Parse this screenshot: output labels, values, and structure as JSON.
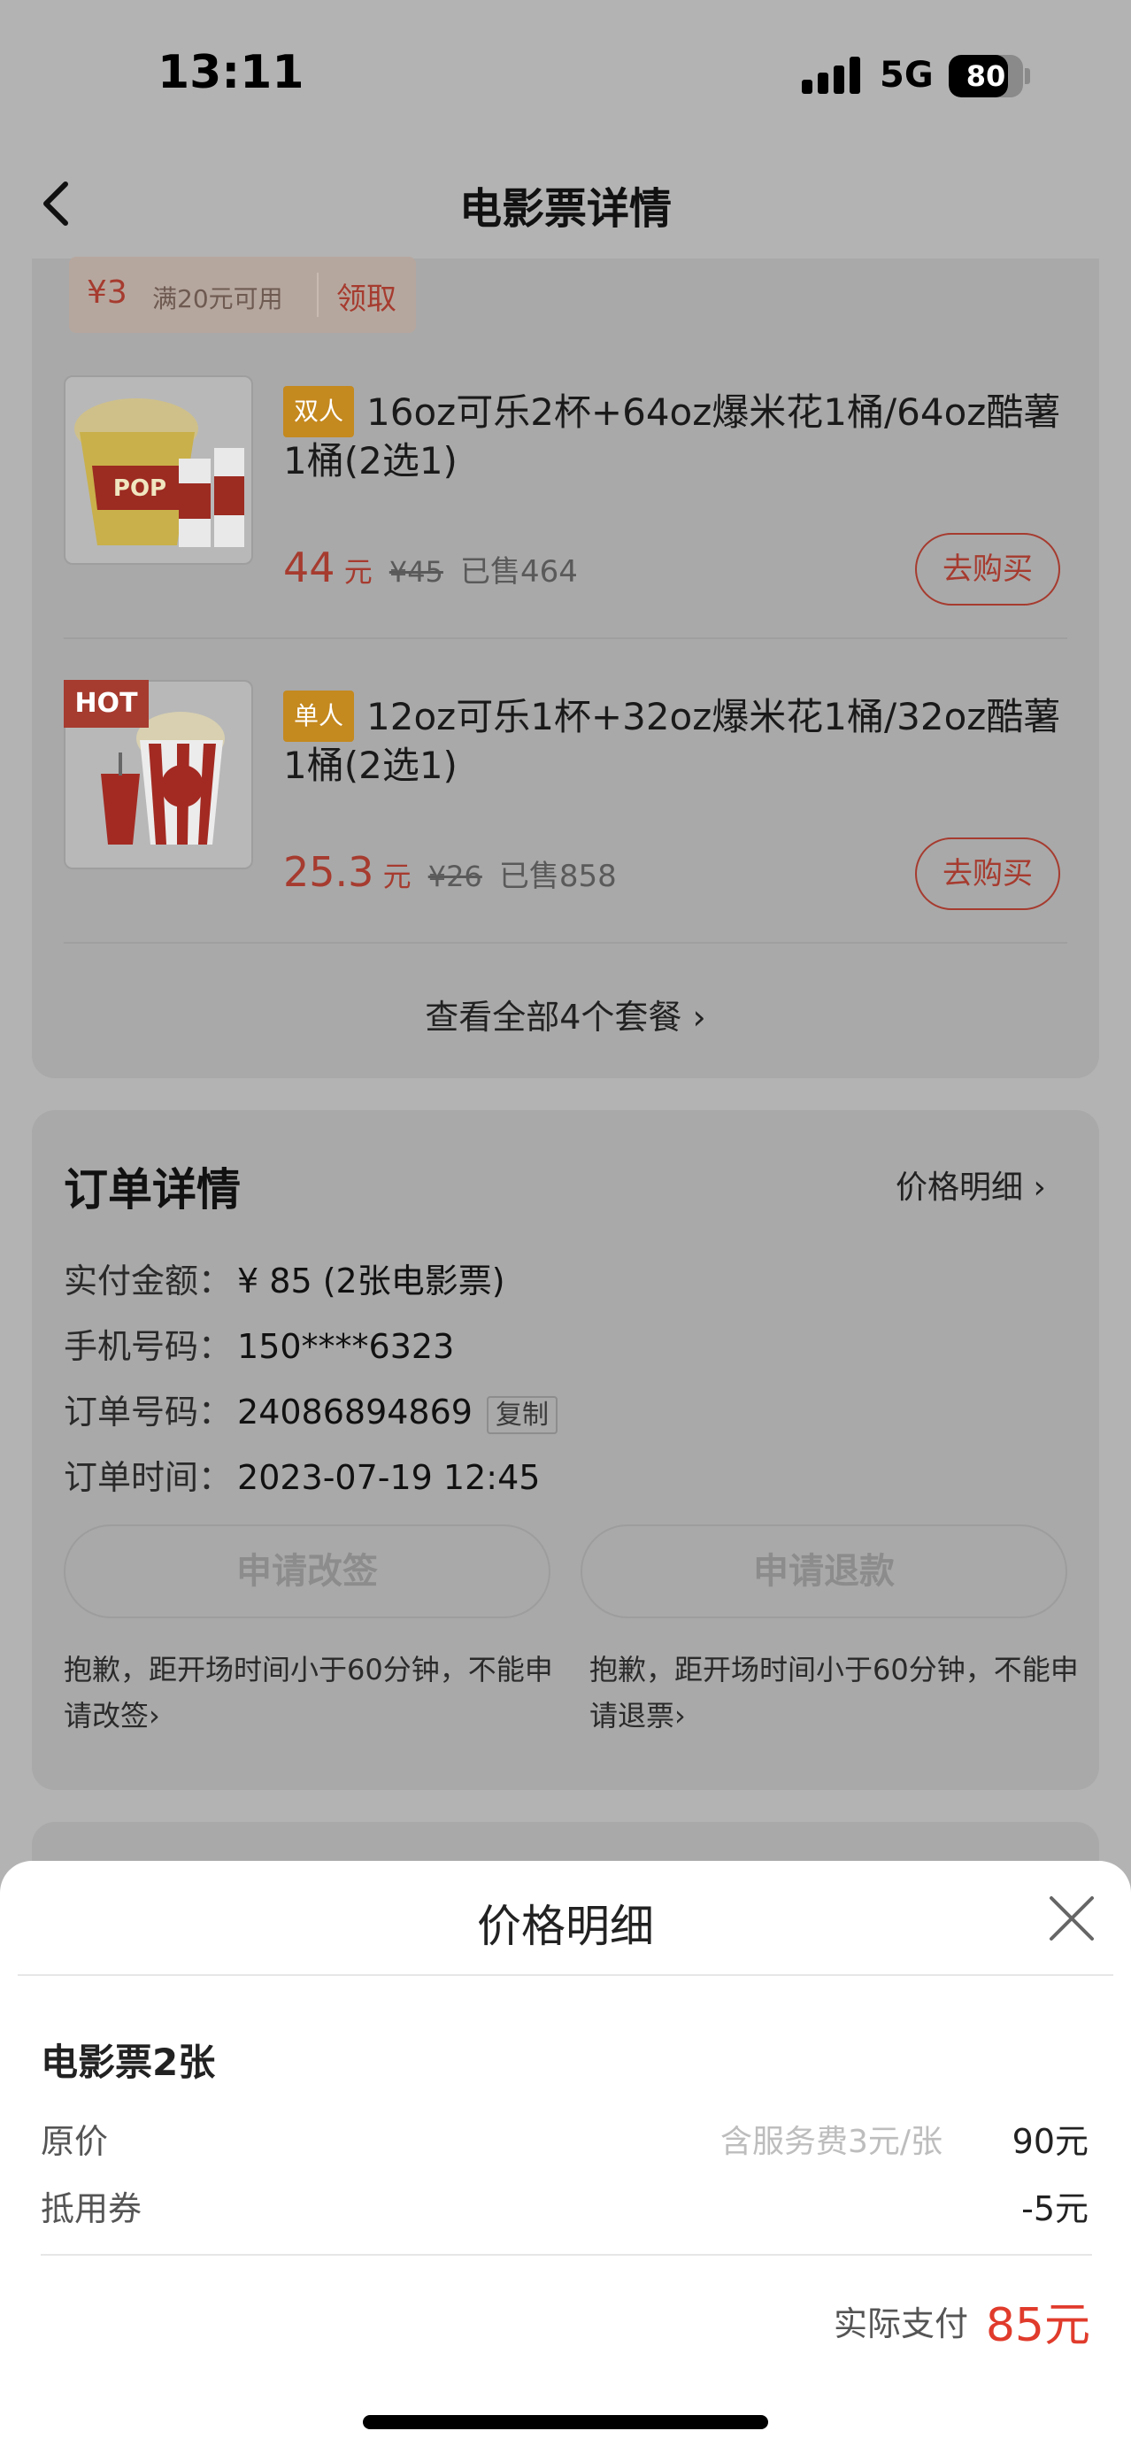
{
  "status_bar": {
    "time": "13:11",
    "network": "5G",
    "battery": "80",
    "battery_level": 0.8
  },
  "header": {
    "title": "电影票详情"
  },
  "coupon": {
    "amount": "¥3",
    "condition": "满20元可用",
    "claim": "领取"
  },
  "products": [
    {
      "tag": "双人",
      "name": "16oz可乐2杯+64oz爆米花1桶/64oz酷薯1桶(2选1)",
      "price": "44",
      "unit": "元",
      "old_price": "¥45",
      "sold": "已售464",
      "buy": "去购买",
      "image": "popcorn-double-icon"
    },
    {
      "badge": "HOT",
      "tag": "单人",
      "name": "12oz可乐1杯+32oz爆米花1桶/32oz酷薯1桶(2选1)",
      "price": "25.3",
      "unit": "元",
      "old_price": "¥26",
      "sold": "已售858",
      "buy": "去购买",
      "image": "popcorn-single-icon"
    }
  ],
  "view_all": "查看全部4个套餐",
  "order": {
    "title": "订单详情",
    "price_detail_link": "价格明细",
    "rows": [
      {
        "label": "实付金额：",
        "value": "¥ 85 (2张电影票)"
      },
      {
        "label": "手机号码：",
        "value": "150****6323"
      },
      {
        "label": "订单号码：",
        "value": "24086894869",
        "action": "复制"
      },
      {
        "label": "订单时间：",
        "value": "2023-07-19 12:45"
      }
    ],
    "change_button": "申请改签",
    "refund_button": "申请退款",
    "change_note": "抱歉，距开场时间小于60分钟，不能申请改签",
    "refund_note": "抱歉，距开场时间小于60分钟，不能申请退票"
  },
  "sheet": {
    "title": "价格明细",
    "section": "电影票2张",
    "original_label": "原价",
    "original_hint": "含服务费3元/张",
    "original_value": "90元",
    "coupon_label": "抵用券",
    "coupon_value": "-5元",
    "pay_label": "实际支付",
    "pay_value": "85元"
  },
  "colors": {
    "accent": "#e03b2c",
    "dim_overlay": "#b3b3b3"
  }
}
